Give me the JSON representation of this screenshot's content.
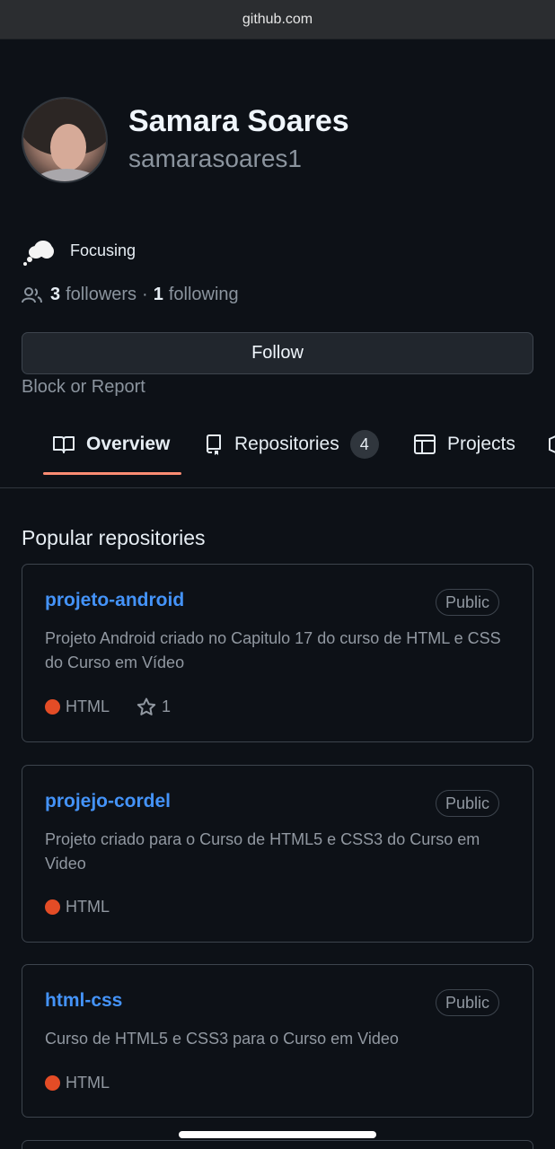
{
  "browser": {
    "url": "github.com"
  },
  "profile": {
    "name": "Samara Soares",
    "login": "samarasoares1",
    "status": {
      "emoji": "thought-balloon",
      "text": "Focusing"
    },
    "followers_count": "3",
    "followers_label": "followers",
    "separator": "·",
    "following_count": "1",
    "following_label": "following",
    "follow_button": "Follow",
    "block_link": "Block or Report"
  },
  "tabs": [
    {
      "label": "Overview",
      "icon": "book-icon",
      "active": true
    },
    {
      "label": "Repositories",
      "icon": "repo-icon",
      "count": "4"
    },
    {
      "label": "Projects",
      "icon": "table-icon"
    }
  ],
  "popular": {
    "title": "Popular repositories",
    "repos": [
      {
        "name": "projeto-android",
        "visibility": "Public",
        "description": "Projeto Android criado no Capitulo 17 do curso de HTML e CSS do Curso em Vídeo",
        "language": "HTML",
        "stars": "1"
      },
      {
        "name": "projejo-cordel",
        "visibility": "Public",
        "description": "Projeto criado para o Curso de HTML5 e CSS3 do Curso em Video",
        "language": "HTML"
      },
      {
        "name": "html-css",
        "visibility": "Public",
        "description": "Curso de HTML5 e CSS3 para o Curso em Video",
        "language": "HTML"
      }
    ]
  },
  "colors": {
    "accent_link": "#4493f8",
    "tab_underline": "#fd8c73",
    "html_language": "#e34c26",
    "background": "#0d1117"
  }
}
